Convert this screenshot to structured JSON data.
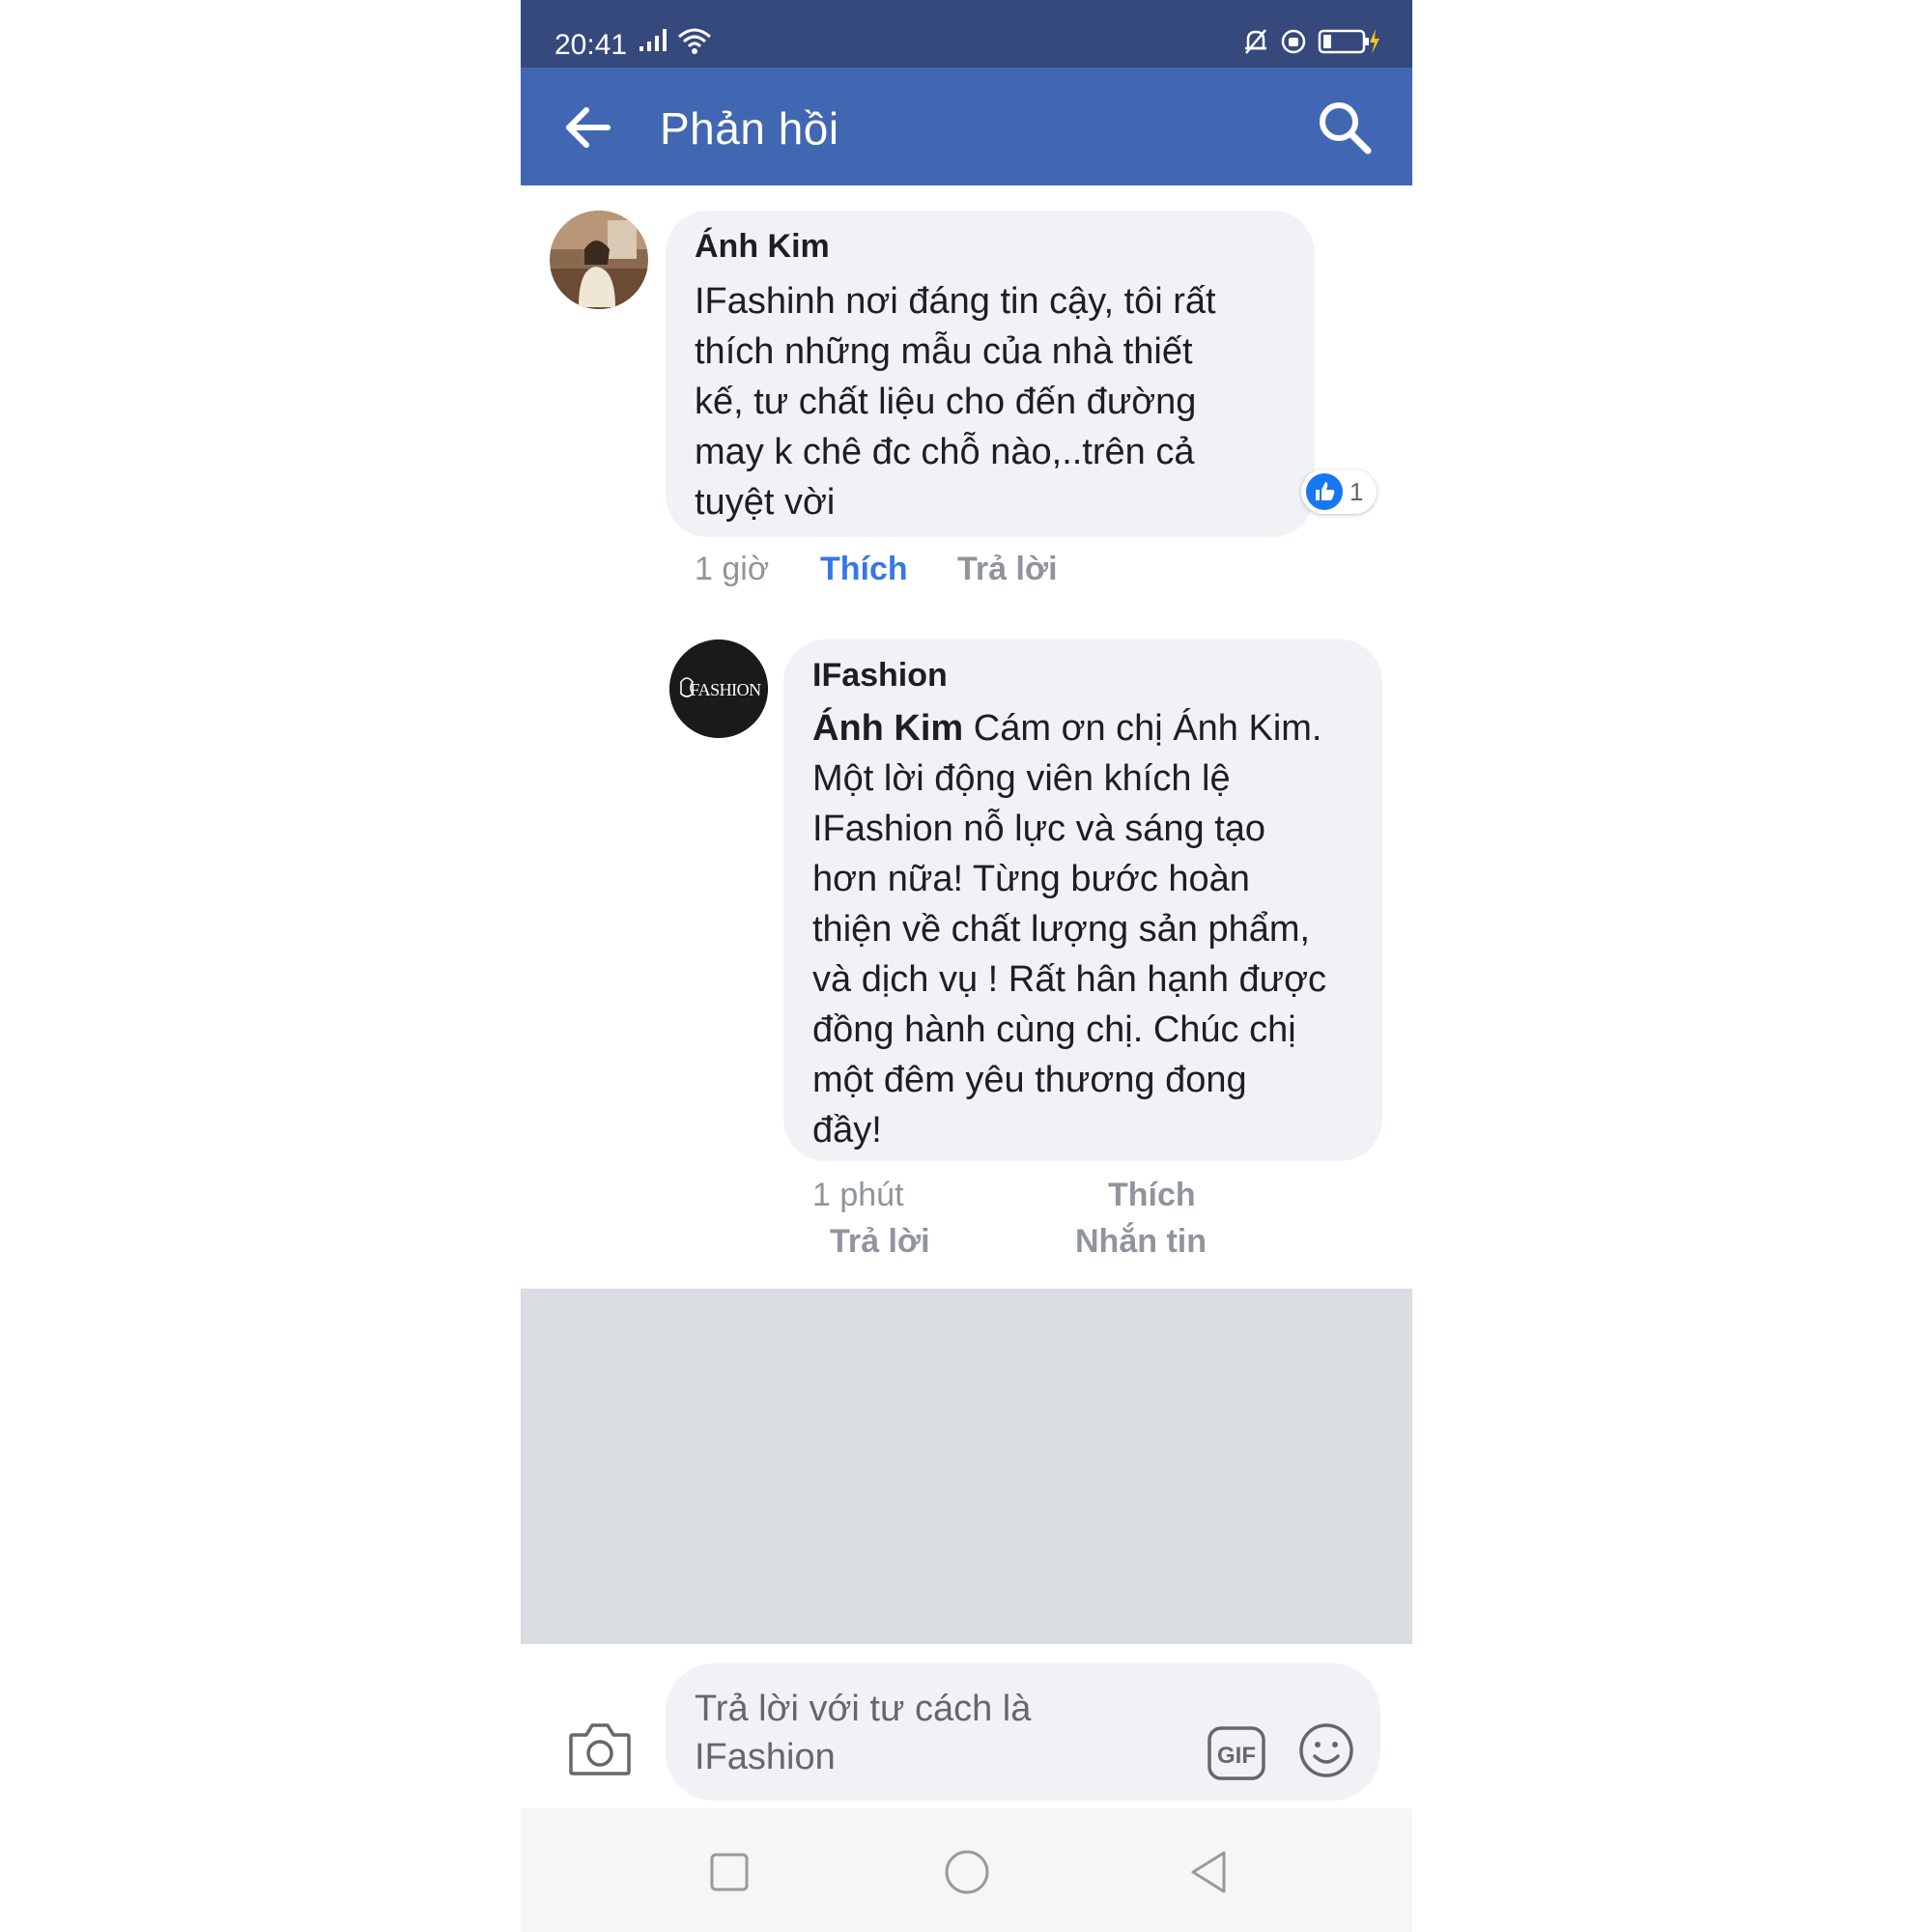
{
  "status_bar": {
    "time": "20:41",
    "icons": [
      "signal-icon",
      "wifi-icon",
      "mute-icon",
      "alarm-icon",
      "battery-charging-icon"
    ]
  },
  "app_bar": {
    "title": "Phản hồi",
    "icons": [
      "back-arrow-icon",
      "search-icon"
    ]
  },
  "comments": [
    {
      "author": "Ánh Kim",
      "text": "IFashinh nơi  đáng tin cậy, tôi rất\nthích  những  mẫu  của  nhà  thiết\nkế, tư  chất  liệu  cho đến  đường\nmay k chê  đc chỗ nào,..trên  cả\ntuyệt vời",
      "time": "1 giờ",
      "like_label": "Thích",
      "reply_label": "Trả lời",
      "reaction_count": "1",
      "reaction_icon": "like-reaction-icon",
      "liked": true
    },
    {
      "author": "IFashion",
      "mention": "Ánh Kim",
      "text": " Cám ơn chị Ánh Kim.\nMột lời động viên khích lệ\nIFashion nỗ lực và sáng tạo\nhơn nữa! Từng bước hoàn\nthiện về chất lượng sản phẩm,\nvà dịch vụ ! Rất hân hạnh được\nđồng hành cùng chị. Chúc chị\nmột đêm yêu thương đong\nđầy!",
      "time": "1 phút",
      "like_label": "Thích",
      "reply_label": "Trả lời",
      "message_label": "Nhắn tin",
      "avatar_logo_text": "FASHION"
    }
  ],
  "composer": {
    "placeholder": "Trả lời với tư cách là\nIFashion",
    "gif_label": "GIF",
    "icons": [
      "camera-icon",
      "gif-icon",
      "emoji-icon"
    ]
  },
  "nav_bar": {
    "icons": [
      "recent-apps-icon",
      "home-icon",
      "back-icon"
    ]
  },
  "colors": {
    "status_bar": "#36497c",
    "app_bar": "#4267b2",
    "bubble": "#f0f2f5",
    "link_active": "#3578e5",
    "meta_text": "#90949c",
    "filler": "#dadde1"
  }
}
